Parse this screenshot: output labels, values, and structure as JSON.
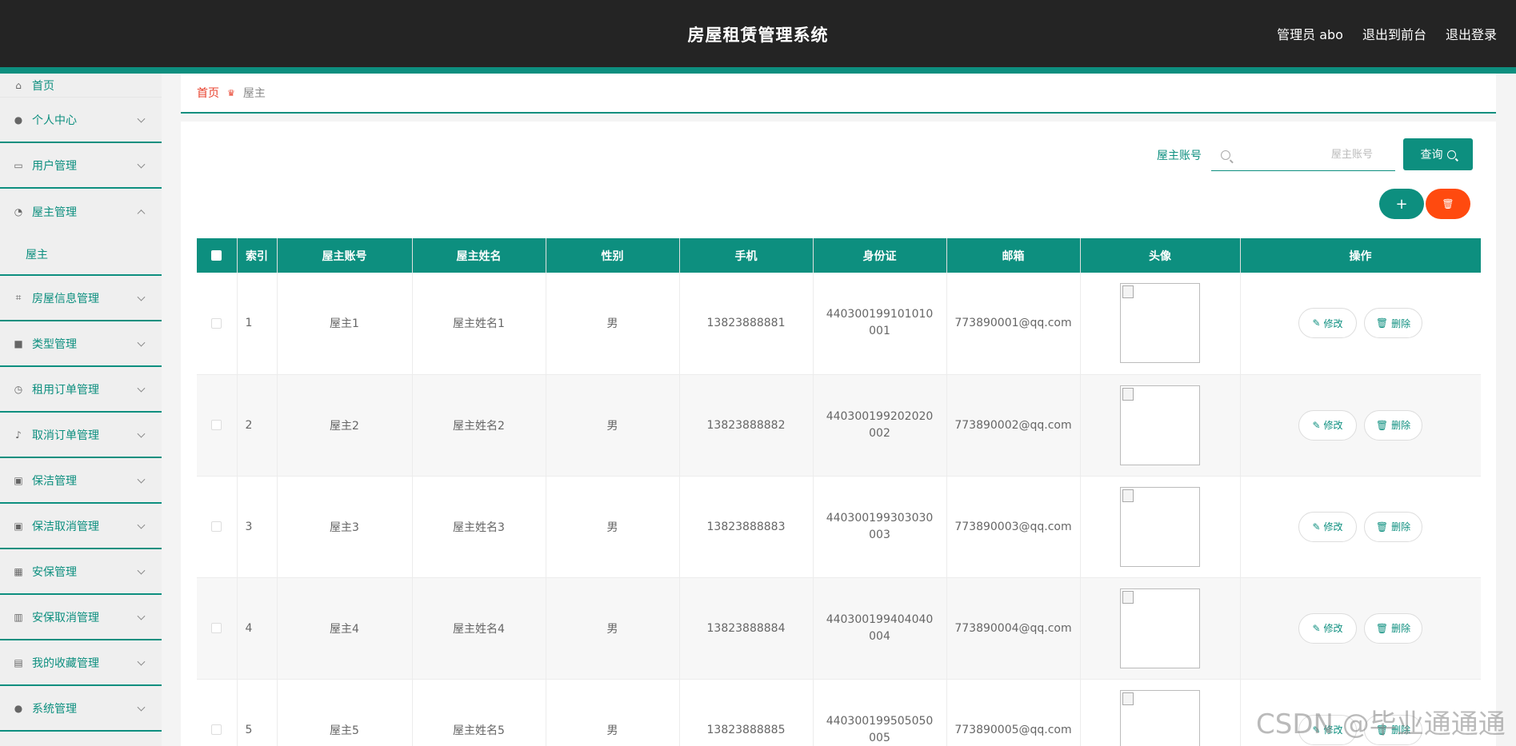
{
  "header": {
    "title": "房屋租赁管理系统",
    "admin": "管理员 abo",
    "to_front": "退出到前台",
    "logout": "退出登录"
  },
  "sidebar": {
    "items": [
      {
        "label": "首页",
        "icon": "home-icon"
      },
      {
        "label": "个人中心",
        "icon": "user-icon"
      },
      {
        "label": "用户管理",
        "icon": "chat-icon"
      },
      {
        "label": "屋主管理",
        "icon": "gauge-icon",
        "expanded": true,
        "children": [
          "屋主"
        ]
      },
      {
        "label": "房屋信息管理",
        "icon": "crop-icon"
      },
      {
        "label": "类型管理",
        "icon": "briefcase-icon"
      },
      {
        "label": "租用订单管理",
        "icon": "clock-icon"
      },
      {
        "label": "取消订单管理",
        "icon": "microphone-icon"
      },
      {
        "label": "保洁管理",
        "icon": "clipboard-icon"
      },
      {
        "label": "保洁取消管理",
        "icon": "clipboard-check-icon"
      },
      {
        "label": "安保管理",
        "icon": "grid-icon"
      },
      {
        "label": "安保取消管理",
        "icon": "bars-icon"
      },
      {
        "label": "我的收藏管理",
        "icon": "clipboard-list-icon"
      },
      {
        "label": "系统管理",
        "icon": "user-settings-icon"
      }
    ]
  },
  "breadcrumb": {
    "home": "首页",
    "current": "屋主"
  },
  "search": {
    "label": "屋主账号",
    "placeholder": "屋主账号",
    "button": "查询"
  },
  "actions": {
    "add": "+",
    "delete": "🗑"
  },
  "table": {
    "headers": [
      "索引",
      "屋主账号",
      "屋主姓名",
      "性别",
      "手机",
      "身份证",
      "邮箱",
      "头像",
      "操作"
    ],
    "rows": [
      {
        "index": "1",
        "account": "屋主1",
        "name": "屋主姓名1",
        "gender": "男",
        "phone": "13823888881",
        "idcard": "440300199101010001",
        "email": "773890001@qq.com"
      },
      {
        "index": "2",
        "account": "屋主2",
        "name": "屋主姓名2",
        "gender": "男",
        "phone": "13823888882",
        "idcard": "440300199202020002",
        "email": "773890002@qq.com"
      },
      {
        "index": "3",
        "account": "屋主3",
        "name": "屋主姓名3",
        "gender": "男",
        "phone": "13823888883",
        "idcard": "440300199303030003",
        "email": "773890003@qq.com"
      },
      {
        "index": "4",
        "account": "屋主4",
        "name": "屋主姓名4",
        "gender": "男",
        "phone": "13823888884",
        "idcard": "440300199404040004",
        "email": "773890004@qq.com"
      },
      {
        "index": "5",
        "account": "屋主5",
        "name": "屋主姓名5",
        "gender": "男",
        "phone": "13823888885",
        "idcard": "440300199505050005",
        "email": "773890005@qq.com"
      }
    ],
    "edit_label": "修改",
    "delete_label": "删除"
  },
  "watermark": "CSDN @毕业通通通",
  "colors": {
    "primary": "#0d8f7f",
    "danger": "#ff4a0f",
    "header_bg": "#242424",
    "breadcrumb_home": "#e8402c"
  }
}
